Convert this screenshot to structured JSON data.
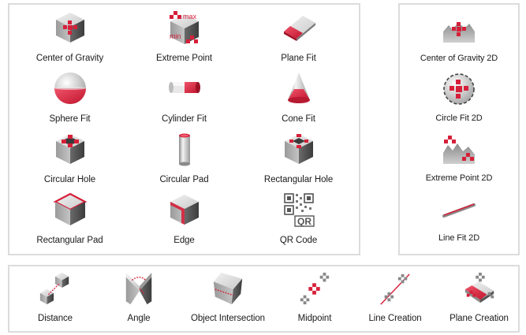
{
  "panel_3d": {
    "items": [
      {
        "label": "Center of Gravity",
        "icon": "center-of-gravity-icon"
      },
      {
        "label": "Extreme Point",
        "icon": "extreme-point-icon",
        "icon_text_top": "max",
        "icon_text_bottom": "min"
      },
      {
        "label": "Plane Fit",
        "icon": "plane-fit-icon"
      },
      {
        "label": "Sphere Fit",
        "icon": "sphere-fit-icon"
      },
      {
        "label": "Cylinder Fit",
        "icon": "cylinder-fit-icon"
      },
      {
        "label": "Cone Fit",
        "icon": "cone-fit-icon"
      },
      {
        "label": "Circular Hole",
        "icon": "circular-hole-icon"
      },
      {
        "label": "Circular Pad",
        "icon": "circular-pad-icon"
      },
      {
        "label": "Rectangular Hole",
        "icon": "rectangular-hole-icon"
      },
      {
        "label": "Rectangular Pad",
        "icon": "rectangular-pad-icon"
      },
      {
        "label": "Edge",
        "icon": "edge-icon"
      },
      {
        "label": "QR Code",
        "icon": "qr-code-icon",
        "icon_text": "QR"
      }
    ]
  },
  "panel_2d": {
    "items": [
      {
        "label": "Center of Gravity 2D",
        "icon": "center-of-gravity-2d-icon"
      },
      {
        "label": "Circle Fit 2D",
        "icon": "circle-fit-2d-icon"
      },
      {
        "label": "Extreme Point 2D",
        "icon": "extreme-point-2d-icon"
      },
      {
        "label": "Line Fit 2D",
        "icon": "line-fit-2d-icon"
      }
    ]
  },
  "panel_ops": {
    "items": [
      {
        "label": "Distance",
        "icon": "distance-icon"
      },
      {
        "label": "Angle",
        "icon": "angle-icon"
      },
      {
        "label": "Object Intersection",
        "icon": "object-intersection-icon"
      },
      {
        "label": "Midpoint",
        "icon": "midpoint-icon"
      },
      {
        "label": "Line Creation",
        "icon": "line-creation-icon"
      },
      {
        "label": "Plane Creation",
        "icon": "plane-creation-icon"
      }
    ]
  },
  "colors": {
    "accent": "#d6203a",
    "gray_light": "#e6e6e6",
    "gray_mid": "#b4b4b4",
    "gray_dark": "#6e6e6e",
    "panel_border": "#dcdcdc"
  }
}
